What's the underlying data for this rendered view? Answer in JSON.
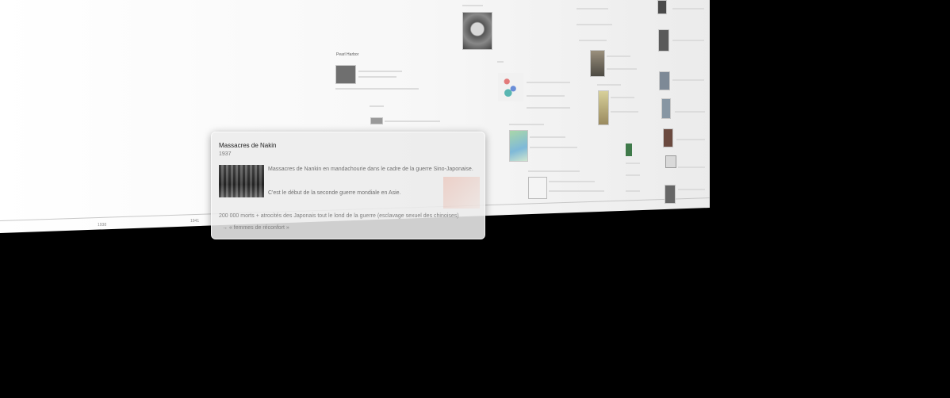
{
  "popup": {
    "title": "Massacres de Nakin",
    "year": "1937",
    "paragraph1": "Massacres de Nankin en mandachourie dans le cadre de la guerre Sino-Japonaise.",
    "paragraph2": "C'est le début de la seconde guerre mondiale en Asie.",
    "paragraph3": "200 000 morts + atrocités des Japonais tout le lond de la guerre (esclavage sexuel des chinoises)",
    "paragraph4": "→ « femmes de réconfort »"
  },
  "timeline": {
    "ticks": [
      "1938",
      "1941"
    ],
    "event_title": "Pearl Harbor"
  }
}
